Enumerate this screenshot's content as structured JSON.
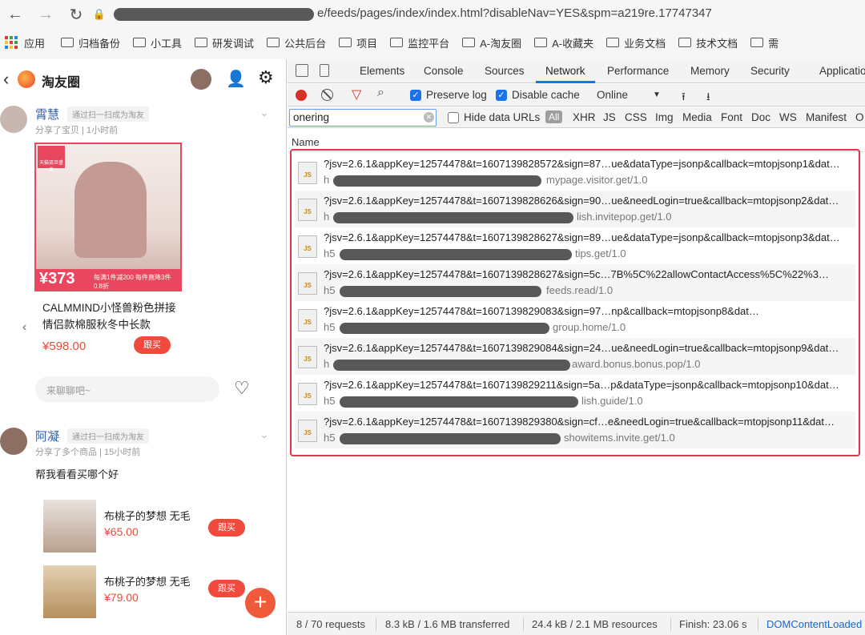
{
  "browser": {
    "url_visible": "e/feeds/pages/index/index.html?disableNav=YES&spm=a219re.17747347",
    "bookmarks": [
      "应用",
      "归档备份",
      "小工具",
      "研发调试",
      "公共后台",
      "项目",
      "监控平台",
      "A-淘友圈",
      "A-收藏夹",
      "业务文档",
      "技术文档",
      "需"
    ]
  },
  "phone": {
    "title": "淘友圈",
    "post1": {
      "name": "霄慧",
      "tag": "通过扫一扫成为淘友",
      "meta": "分享了宝贝 | 1小时前",
      "badge": "天猫双旦盛典",
      "strip_price": "¥373",
      "strip_text": "每满1件减200 每件直降3件 0.8折",
      "product_title": "CALMMIND小怪兽粉色拼接情侣款棉服秋冬中长款",
      "product_price": "¥598.00",
      "buy_label": "跟买",
      "comment_placeholder": "来聊聊吧~"
    },
    "post2": {
      "name": "阿凝",
      "tag": "通过扫一扫成为淘友",
      "meta": "分享了多个商品 | 15小时前",
      "text": "帮我看看买哪个好",
      "items": [
        {
          "name": "布桃子的梦想 无毛",
          "price": "¥65.00",
          "buy": "跟买"
        },
        {
          "name": "布桃子的梦想 无毛",
          "price": "¥79.00",
          "buy": "跟买"
        }
      ]
    },
    "fab": "+"
  },
  "devtools": {
    "tabs": [
      "Elements",
      "Console",
      "Sources",
      "Network",
      "Performance",
      "Memory",
      "Security",
      "Applicatio"
    ],
    "active_tab": "Network",
    "toolbar": {
      "preserve_log": "Preserve log",
      "disable_cache": "Disable cache",
      "throttle": "Online"
    },
    "filter": {
      "value": "onering",
      "hide_data_urls": "Hide data URLs",
      "all": "All",
      "types": [
        "XHR",
        "JS",
        "CSS",
        "Img",
        "Media",
        "Font",
        "Doc",
        "WS",
        "Manifest",
        "O"
      ]
    },
    "column_name": "Name",
    "requests": [
      {
        "line1": "?jsv=2.6.1&appKey=12574478&t=1607139828572&sign=87…ue&dataType=jsonp&callback=mtopjsonp1&dat…",
        "prefix": "h",
        "path": "mypage.visitor.get/1.0"
      },
      {
        "line1": "?jsv=2.6.1&appKey=12574478&t=1607139828626&sign=90…ue&needLogin=true&callback=mtopjsonp2&dat…",
        "prefix": "h",
        "path": "lish.invitepop.get/1.0"
      },
      {
        "line1": "?jsv=2.6.1&appKey=12574478&t=1607139828627&sign=89…ue&dataType=jsonp&callback=mtopjsonp3&dat…",
        "prefix": "h5",
        "path": "tips.get/1.0"
      },
      {
        "line1": "?jsv=2.6.1&appKey=12574478&t=1607139828627&sign=5c…7B%5C%22allowContactAccess%5C%22%3…",
        "prefix": "h5",
        "path": "feeds.read/1.0"
      },
      {
        "line1": "?jsv=2.6.1&appKey=12574478&t=1607139829083&sign=97…np&callback=mtopjsonp8&dat…",
        "prefix": "h5",
        "path": "group.home/1.0"
      },
      {
        "line1": "?jsv=2.6.1&appKey=12574478&t=1607139829084&sign=24…ue&needLogin=true&callback=mtopjsonp9&dat…",
        "prefix": "h",
        "path": "award.bonus.bonus.pop/1.0"
      },
      {
        "line1": "?jsv=2.6.1&appKey=12574478&t=1607139829211&sign=5a…p&dataType=jsonp&callback=mtopjsonp10&dat…",
        "prefix": "h5",
        "path": "lish.guide/1.0"
      },
      {
        "line1": "?jsv=2.6.1&appKey=12574478&t=1607139829380&sign=cf…e&needLogin=true&callback=mtopjsonp11&dat…",
        "prefix": "h5",
        "path": "showitems.invite.get/1.0"
      }
    ],
    "status": {
      "requests": "8 / 70 requests",
      "transferred": "8.3 kB / 1.6 MB transferred",
      "resources": "24.4 kB / 2.1 MB resources",
      "finish": "Finish: 23.06 s",
      "dcl": "DOMContentLoaded"
    }
  },
  "colors": {
    "accent": "#1a73e8",
    "highlight_box": "#e2334a",
    "brand": "#ef4a3b"
  }
}
